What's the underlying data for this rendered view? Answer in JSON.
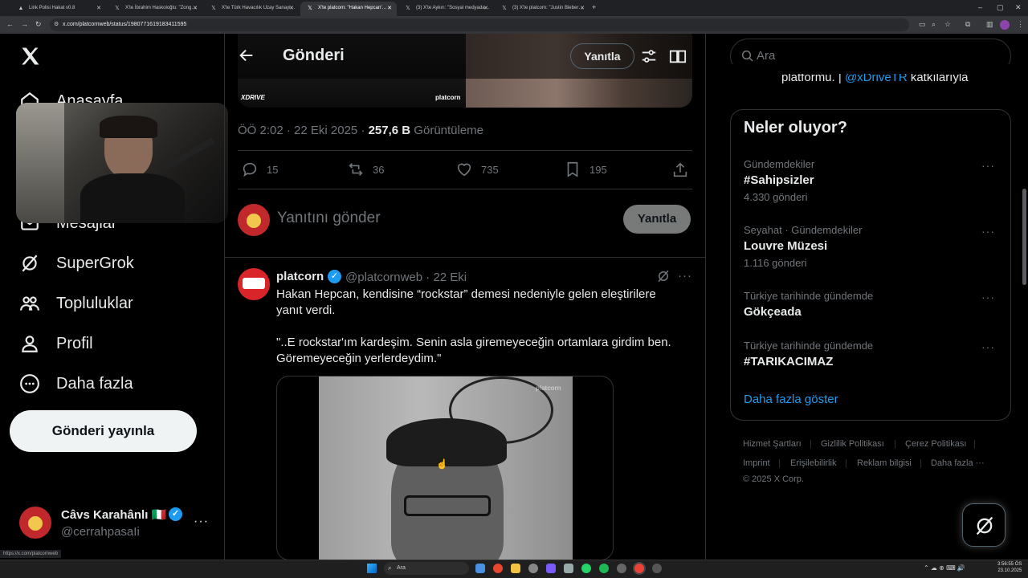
{
  "browser": {
    "tabs": [
      {
        "label": "Link Polisi Hakat v0.8"
      },
      {
        "label": "X'te İbrahim Haskoloğlu: \"Zong…"
      },
      {
        "label": "X'te Türk Havacılık Uzay Sanayi…"
      },
      {
        "label": "X'te platcorn: \"Hakan Hepcan'…"
      },
      {
        "label": "(3) X'te Aykırı: \"Sosyal medyada…"
      },
      {
        "label": "(3) X'te platcorn: \"Justin Bieber…"
      }
    ],
    "url": "x.com/platcornweb/status/1980771619183411595",
    "status_url": "https://x.com/platcornweb"
  },
  "nav": {
    "items": [
      {
        "label": "Anasayfa"
      },
      {
        "label": "Mesajlar"
      },
      {
        "label": "SuperGrok"
      },
      {
        "label": "Topluluklar"
      },
      {
        "label": "Profil"
      },
      {
        "label": "Daha fazla"
      }
    ],
    "post_button": "Gönderi yayınla",
    "account": {
      "name": "Câvs Karahânlı 🇮🇹",
      "handle": "@cerrahpasaIi"
    }
  },
  "header": {
    "title": "Gönderi",
    "reply_label": "Yanıtla"
  },
  "main_post": {
    "media_brand_left": "XDRIVE",
    "media_brand_right": "platcorn",
    "time": "ÖÖ 2:02 · 22 Eki 2025 · ",
    "views": "257,6 B",
    "views_label": " Görüntüleme",
    "stats": {
      "replies": "15",
      "reposts": "36",
      "likes": "735",
      "bookmarks": "195"
    }
  },
  "reply_box": {
    "placeholder": "Yanıtını gönder",
    "button": "Yanıtla"
  },
  "tweet": {
    "name": "platcorn",
    "handle": "@platcornweb · 22 Eki",
    "text": "Hakan Hepcan, kendisine “rockstar” demesi nedeniyle gelen eleştirilere yanıt verdi.\n\n\"..E rockstar'ım kardeşim. Senin asla giremeyeceğin ortamlara girdim ben. Göremeyeceğin yerlerdeydim.\"",
    "video_watermark": "platcorn"
  },
  "sidebar": {
    "search_placeholder": "Ara",
    "partial_text_a": "platformu. | ",
    "partial_text_b": "@xDriveTR",
    "partial_text_c": " katkılarıyla",
    "trends_title": "Neler oluyor?",
    "trends": [
      {
        "category": "Gündemdekiler",
        "name": "#Sahipsizler",
        "count": "4.330 gönderi"
      },
      {
        "category": "Seyahat · Gündemdekiler",
        "name": "Louvre Müzesi",
        "count": "1.116 gönderi"
      },
      {
        "category": "Türkiye tarihinde gündemde",
        "name": "Gökçeada",
        "count": ""
      },
      {
        "category": "Türkiye tarihinde gündemde",
        "name": "#TARIKACIMAZ",
        "count": ""
      }
    ],
    "show_more": "Daha fazla göster",
    "footer": {
      "links": [
        "Hizmet Şartları",
        "Gizlilik Politikası",
        "Çerez Politikası",
        "Imprint",
        "Erişilebilirlik",
        "Reklam bilgisi",
        "Daha fazla ···"
      ],
      "copyright": "© 2025 X Corp."
    }
  },
  "taskbar": {
    "search": "Ara",
    "time": "3:56:55 ÖS",
    "date": "23.10.2025"
  },
  "colors": {
    "accent": "#1d9bf0",
    "background": "#000000",
    "border": "#2f3336",
    "muted": "#71767b"
  }
}
